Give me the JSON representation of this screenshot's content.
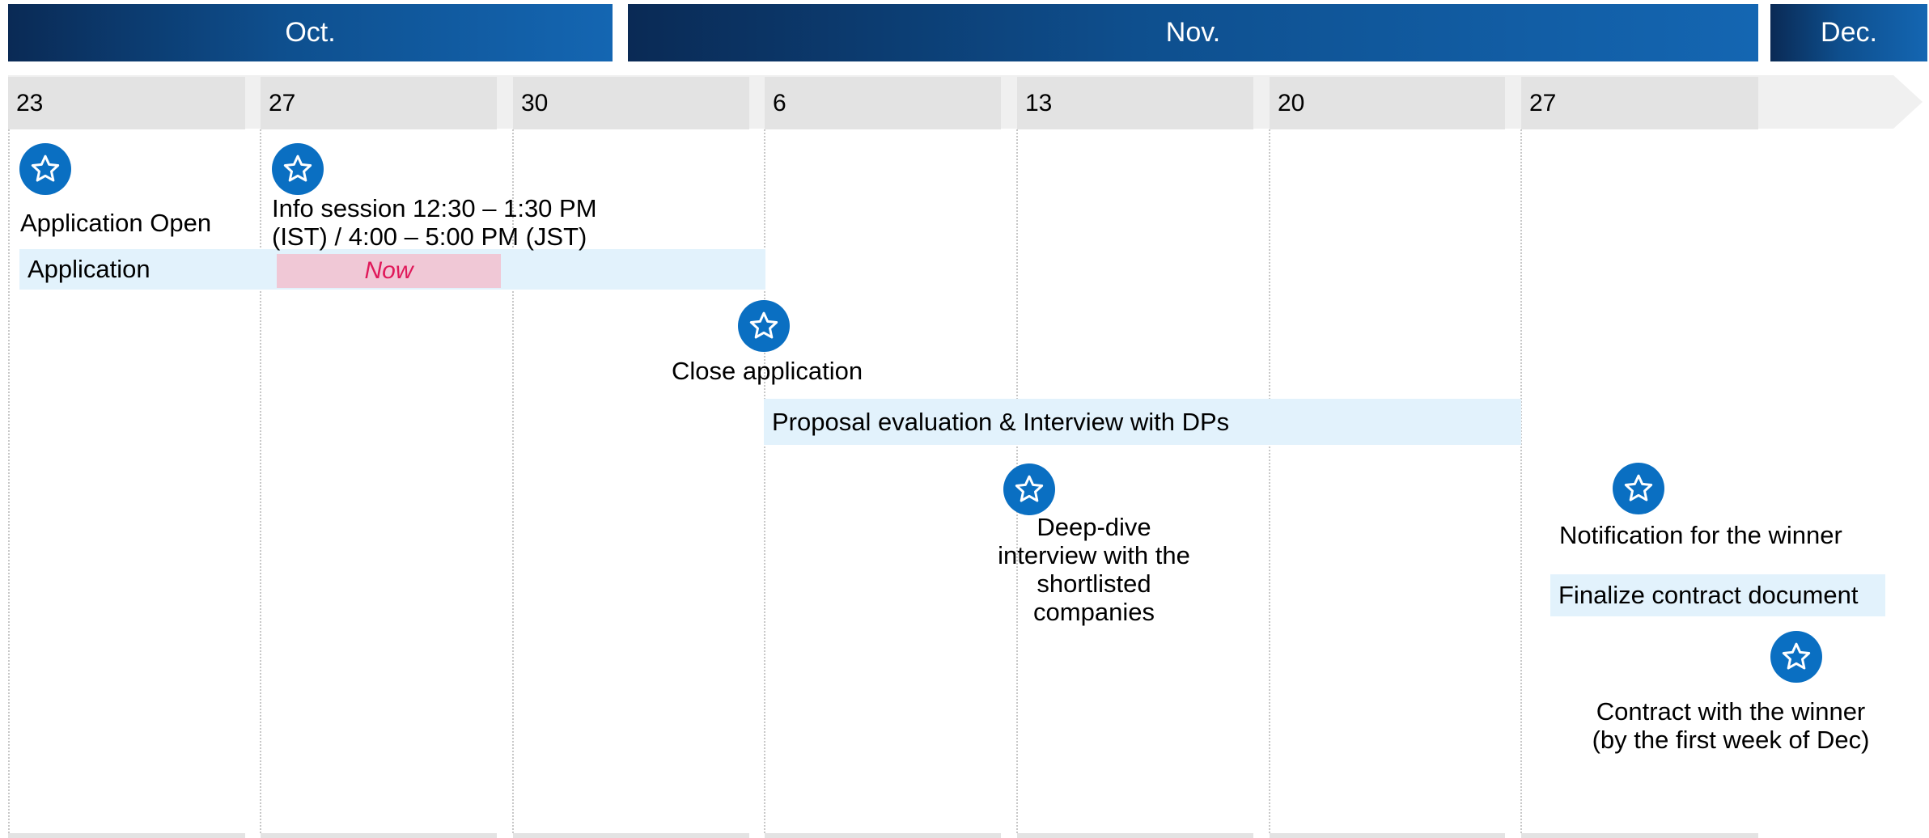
{
  "months": {
    "oct": "Oct.",
    "nov": "Nov.",
    "dec": "Dec."
  },
  "weeks": [
    "23",
    "27",
    "30",
    "6",
    "13",
    "20",
    "27"
  ],
  "bars": {
    "application": "Application",
    "now": "Now",
    "proposal": "Proposal evaluation & Interview with DPs",
    "finalize": "Finalize contract document"
  },
  "milestones": {
    "application_open": "Application Open",
    "info_session_line1": "Info session 12:30 – 1:30 PM",
    "info_session_line2": "(IST) / 4:00 – 5:00 PM (JST)",
    "close_application": "Close application",
    "deep_dive_line1": "Deep-dive",
    "deep_dive_line2": "interview with the",
    "deep_dive_line3": "shortlisted",
    "deep_dive_line4": "companies",
    "notification": "Notification for the winner",
    "contract_line1": "Contract with the winner",
    "contract_line2": "(by the first week of Dec)"
  },
  "colors": {
    "month_header": "#1466b2",
    "star_icon": "#0a6fc2",
    "bar_fill": "#e2f2fc",
    "now_fill": "#f0c8d6",
    "now_text": "#e0195a"
  },
  "icons": {
    "milestone": "star-icon"
  }
}
